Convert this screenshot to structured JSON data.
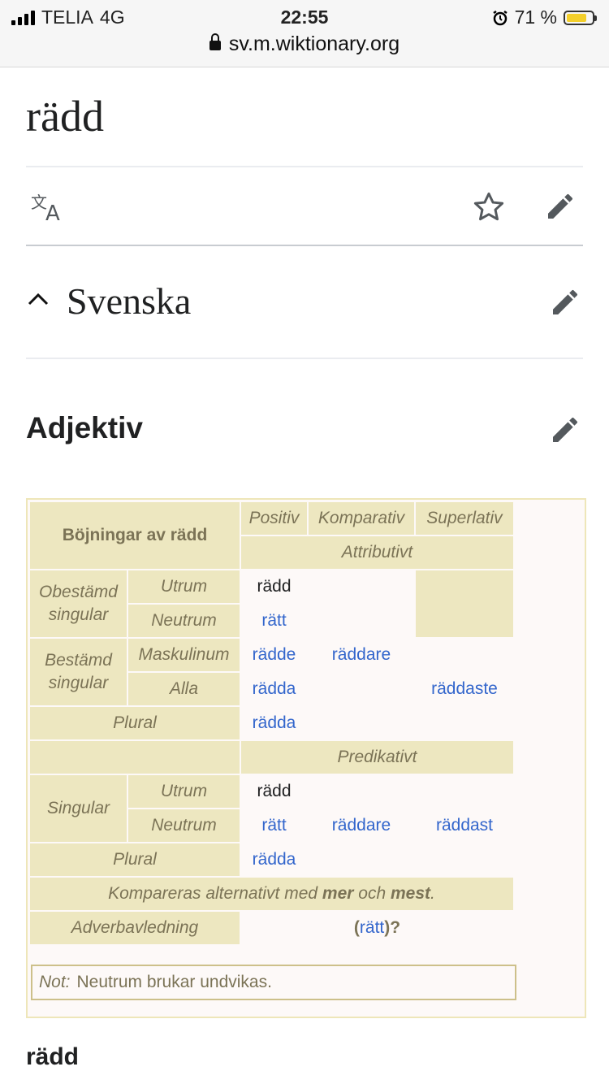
{
  "status_bar": {
    "carrier": "TELIA",
    "network": "4G",
    "time": "22:55",
    "battery": "71 %"
  },
  "browser": {
    "url": "sv.m.wiktionary.org"
  },
  "page": {
    "title": "rädd",
    "section": "Svenska",
    "subsection": "Adjektiv",
    "footer_heading": "rädd"
  },
  "table": {
    "caption": "Böjningar av rädd",
    "degrees": {
      "positive": "Positiv",
      "comparative": "Komparativ",
      "superlative": "Superlativ"
    },
    "attributive": "Attributivt",
    "predicative": "Predikativt",
    "labels": {
      "indef_singular": "Obestämd singular",
      "def_singular": "Bestämd singular",
      "plural": "Plural",
      "singular": "Singular",
      "utrum": "Utrum",
      "neutrum": "Neutrum",
      "maskulinum": "Maskulinum",
      "alla": "Alla",
      "adverb": "Adverbavledning"
    },
    "forms": {
      "attr_utrum": "rädd",
      "attr_neutrum": "rätt",
      "def_mask_pos": "rädde",
      "def_mask_comp": "räddare",
      "def_alla_pos": "rädda",
      "def_alla_sup": "räddaste",
      "attr_plural": "rädda",
      "pred_utrum": "rädd",
      "pred_neutrum_pos": "rätt",
      "pred_neutrum_comp": "räddare",
      "pred_neutrum_sup": "räddast",
      "pred_plural": "rädda",
      "adverb_open": "(",
      "adverb_value": "rätt",
      "adverb_close": ")?"
    },
    "compare_note": {
      "pre": "Kompareras alternativt med ",
      "mer": "mer",
      "och": " och ",
      "mest": "mest",
      "end": "."
    },
    "footnote": {
      "label": "Not:",
      "text": "Neutrum brukar undvikas."
    }
  }
}
